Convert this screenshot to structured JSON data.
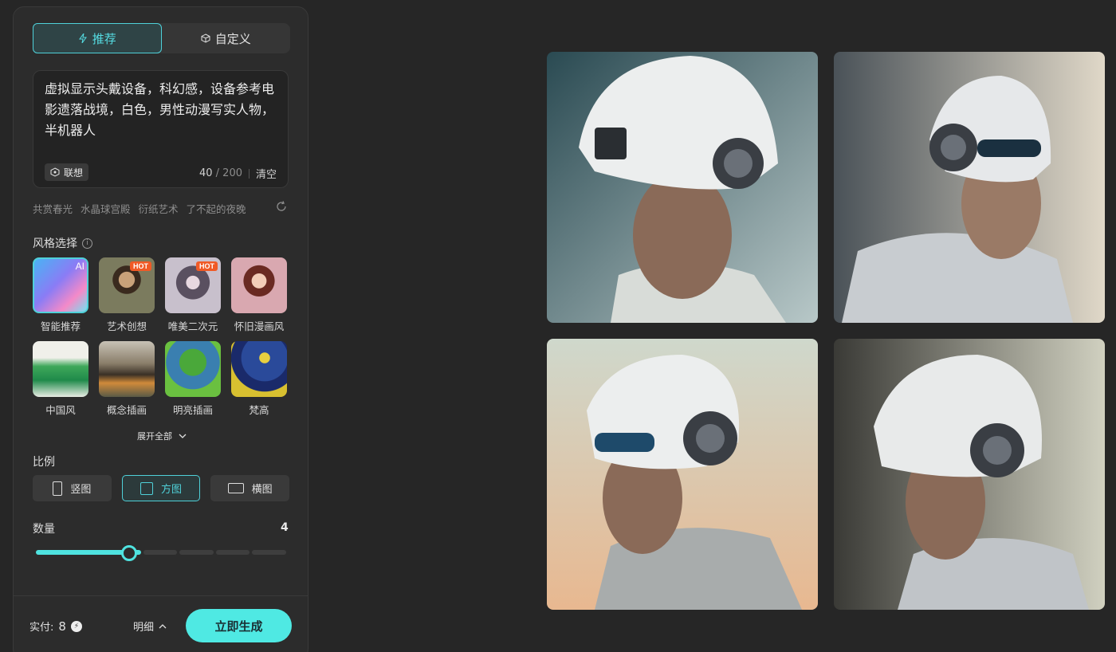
{
  "mode_tabs": [
    {
      "label": "推荐",
      "active": true
    },
    {
      "label": "自定义",
      "active": false
    }
  ],
  "prompt": {
    "text": "虚拟显示头戴设备，科幻感，设备参考电影遗落战境，白色，男性动漫写实人物，半机器人",
    "assoc_label": "联想",
    "count": "40",
    "max": "/ 200",
    "clear_label": "清空"
  },
  "suggestions": [
    "共赏春光",
    "水晶球宫殿",
    "衍纸艺术",
    "了不起的夜晚"
  ],
  "style_section": {
    "title": "风格选择",
    "items": [
      {
        "name": "智能推荐",
        "badge": "AI",
        "selected": true
      },
      {
        "name": "艺术创想",
        "badge": "HOT"
      },
      {
        "name": "唯美二次元",
        "badge": "HOT"
      },
      {
        "name": "怀旧漫画风",
        "badge": ""
      },
      {
        "name": "中国风",
        "badge": ""
      },
      {
        "name": "概念插画",
        "badge": ""
      },
      {
        "name": "明亮插画",
        "badge": ""
      },
      {
        "name": "梵高",
        "badge": ""
      }
    ],
    "expand_label": "展开全部"
  },
  "ratio_section": {
    "title": "比例",
    "options": [
      {
        "label": "竖图",
        "active": false
      },
      {
        "label": "方图",
        "active": true
      },
      {
        "label": "横图",
        "active": false
      }
    ]
  },
  "quantity_section": {
    "title": "数量",
    "value": "4",
    "fraction": 0.375
  },
  "footer": {
    "paid_label": "实付:",
    "paid_value": "8",
    "details_label": "明细",
    "generate_label": "立即生成"
  },
  "colors": {
    "accent": "#4fe3e0",
    "hot_badge": "#f05a26",
    "background": "#262626",
    "panel": "#2c2c2c"
  }
}
